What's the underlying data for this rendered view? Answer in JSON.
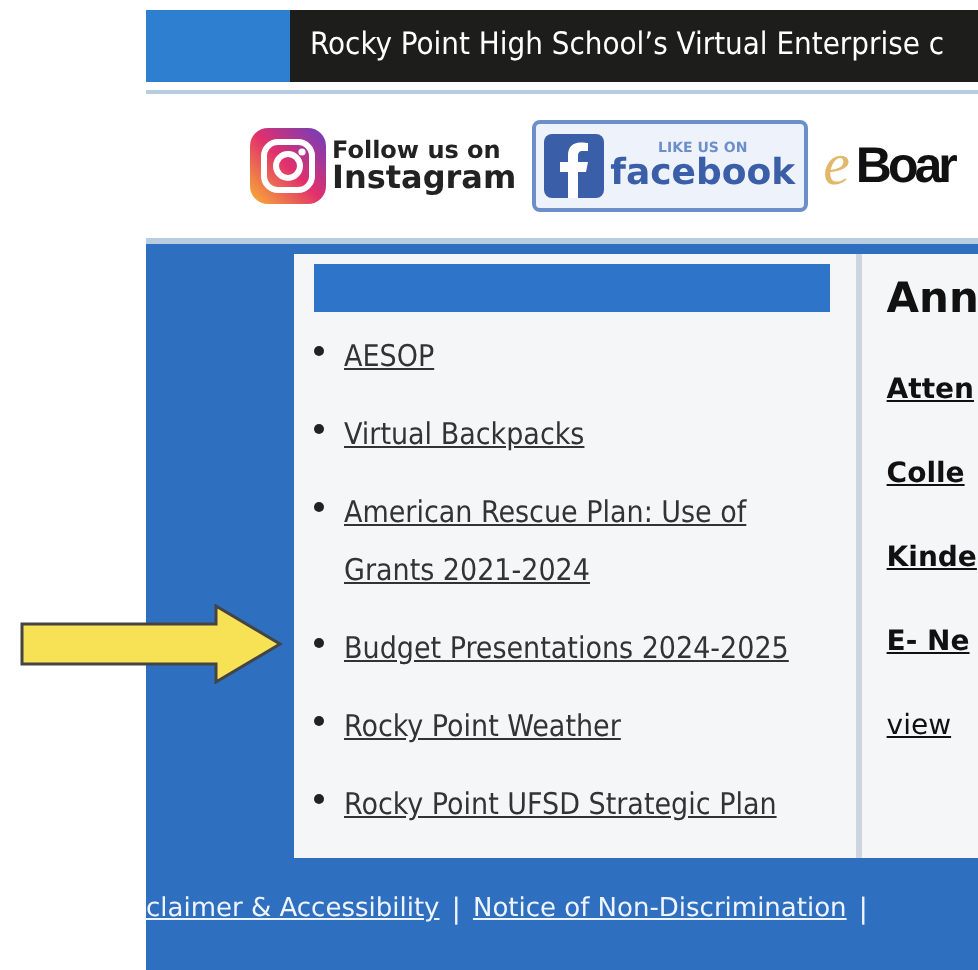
{
  "banner": {
    "title": "Rocky Point High School’s Virtual Enterprise c"
  },
  "social": [
    {
      "kind": "instagram",
      "line1": "Follow us on",
      "line2": "Instagram"
    },
    {
      "kind": "facebook",
      "line1": "LIKE US ON",
      "line2": "facebook"
    },
    {
      "kind": "eboard",
      "line1": "e",
      "line2": "Boar"
    }
  ],
  "links": [
    "AESOP",
    "Virtual Backpacks",
    "American Rescue Plan: Use of Grants 2021-2024",
    "Budget Presentations 2024-2025",
    "Rocky Point Weather",
    "Rocky Point UFSD Strategic Plan"
  ],
  "announcements": {
    "heading": "Ann",
    "items": [
      {
        "kind": "bold",
        "text": "Atten"
      },
      {
        "kind": "bold",
        "text": "Colle"
      },
      {
        "kind": "bold",
        "text": "Kinde"
      },
      {
        "kind": "bold",
        "text": "E- Ne"
      },
      {
        "kind": "plain",
        "text": "view"
      }
    ]
  },
  "footer": [
    "claimer & Accessibility",
    "|",
    "Notice of Non-Discrimination",
    "|"
  ]
}
